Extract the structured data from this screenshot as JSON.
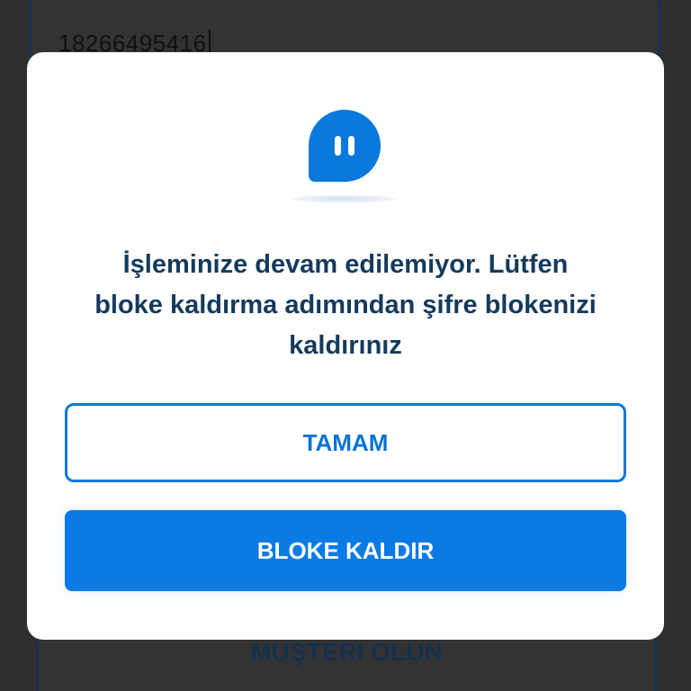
{
  "background": {
    "phone_input_value": "18266495416",
    "bottom_button_label": "MUŞTERI OLUN"
  },
  "dialog": {
    "icon": "pause-chat-bubble-icon",
    "message_lines": [
      "İşleminize devam edilemiyor. Lütfen",
      "bloke kaldırma adımından şifre blokenizi",
      "kaldırınız"
    ],
    "ok_button_label": "TAMAM",
    "unblock_button_label": "BLOKE KALDIR"
  },
  "colors": {
    "accent": "#0a7ae5",
    "message_text": "#143a5c",
    "overlay": "#2f2f2f"
  }
}
